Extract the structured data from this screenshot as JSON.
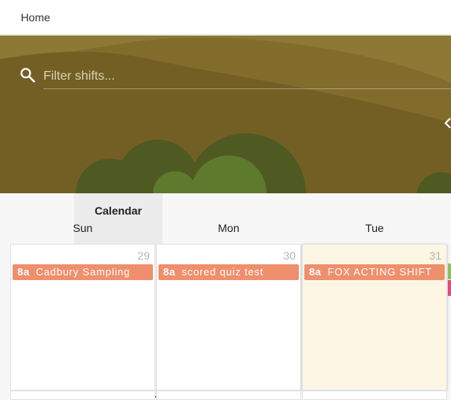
{
  "tabs": [
    {
      "label": "Home"
    },
    {
      "label": "Calendar"
    }
  ],
  "search": {
    "placeholder": "Filter shifts..."
  },
  "colors": {
    "banner_dark": "#6b5a1e",
    "banner_mid": "#826c2c",
    "bush_dark": "#4f5a22",
    "bush_light": "#5e7a2d",
    "shift": "#ef8f6c",
    "today_bg": "#fdf6e5"
  },
  "calendar": {
    "days": [
      {
        "dow": "Sun",
        "date": "29",
        "shift_time": "8a",
        "shift_title": "Cadbury Sampling"
      },
      {
        "dow": "Mon",
        "date": "30",
        "shift_time": "8a",
        "shift_title": "scored quiz test"
      },
      {
        "dow": "Tue",
        "date": "31",
        "shift_time": "8a",
        "shift_title": "FOX ACTING SHIFT"
      }
    ]
  }
}
